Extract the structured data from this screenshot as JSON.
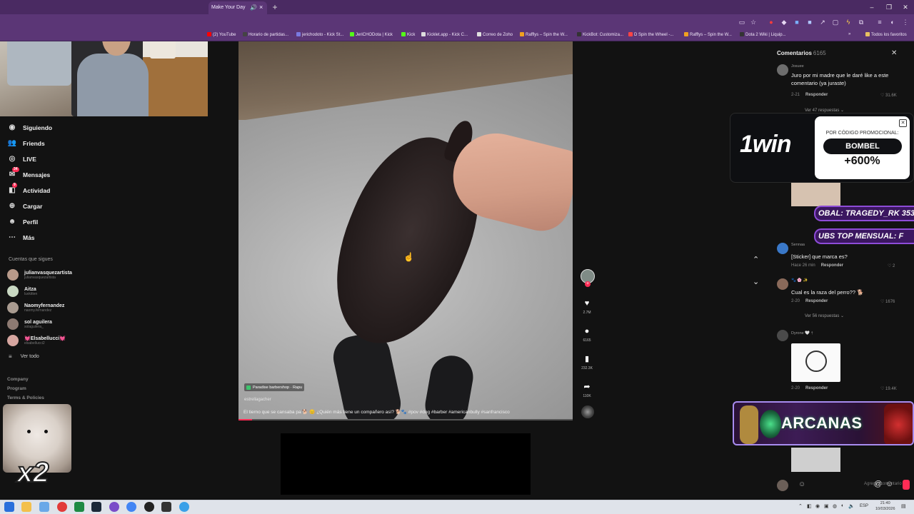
{
  "browser": {
    "active_tab_title": "Make Your Day",
    "bookmarks": [
      {
        "label": "(2) YouTube",
        "color": "#ff0000"
      },
      {
        "label": "Horario de partidas...",
        "color": "#444444"
      },
      {
        "label": "jerichodoto - Kick St...",
        "color": "#7a7ae0"
      },
      {
        "label": "JeriCHODota | Kick",
        "color": "#53fc18"
      },
      {
        "label": "Kick",
        "color": "#53fc18"
      },
      {
        "label": "Kicklet.app - Kick C...",
        "color": "#dddddd"
      },
      {
        "label": "Correo de Zoho",
        "color": "#e0e0e0"
      },
      {
        "label": "Rafflys – Spin the W...",
        "color": "#f0a020"
      },
      {
        "label": "KickBot: Customiza...",
        "color": "#333333"
      },
      {
        "label": "D Spin the Wheel -...",
        "color": "#ff4444"
      },
      {
        "label": "Rafflys – Spin the W...",
        "color": "#f0a020"
      },
      {
        "label": "Dota 2 Wiki | Liquip...",
        "color": "#333333"
      }
    ],
    "all_favorites": "Todos los favoritos"
  },
  "sidebar": {
    "nav": [
      {
        "label": "Siguiendo",
        "icon": "following-icon"
      },
      {
        "label": "Friends",
        "icon": "friends-icon"
      },
      {
        "label": "LIVE",
        "icon": "live-icon"
      },
      {
        "label": "Mensajes",
        "icon": "messages-icon",
        "badge": "34"
      },
      {
        "label": "Actividad",
        "icon": "activity-icon",
        "badge": "9"
      },
      {
        "label": "Cargar",
        "icon": "upload-icon"
      },
      {
        "label": "Perfil",
        "icon": "profile-icon"
      },
      {
        "label": "Más",
        "icon": "more-icon"
      }
    ],
    "following_title": "Cuentas que sigues",
    "following": [
      {
        "name": "julianvasquezartista",
        "handle": "julianvasquezartista",
        "color": "#b89a8a"
      },
      {
        "name": "Aitza",
        "handle": "luvkitten",
        "color": "#c9d8c2"
      },
      {
        "name": "Naomyfernandez",
        "handle": "naomy.fernandez",
        "color": "#a99b90"
      },
      {
        "name": "sol aguilera",
        "handle": "solaguilera_",
        "color": "#8d7a72"
      },
      {
        "name": "💓Elsabellucci💓",
        "handle": "elsabellucci2",
        "color": "#d6a6a0"
      }
    ],
    "see_all": "Ver todo",
    "footer": [
      "Company",
      "Program",
      "Terms & Policies"
    ]
  },
  "overlay": {
    "multiplier": "x2"
  },
  "video": {
    "tag": "Paradise barbershop · Rapu",
    "author": "estrellagacher",
    "caption": "El tierno que se cansaba pa 🐕 😊 ¿Quién más tiene un compañero así? 🐕🐾 #pov #dog #barber #americanbully #sanfrancisco",
    "progress": 0.04
  },
  "actions": [
    {
      "name": "like",
      "icon": "heart-icon",
      "glyph": "♥",
      "count": "2.7M"
    },
    {
      "name": "comment",
      "icon": "comment-icon",
      "glyph": "●",
      "count": "6165"
    },
    {
      "name": "save",
      "icon": "bookmark-icon",
      "glyph": "▮",
      "count": "232.3K"
    },
    {
      "name": "share",
      "icon": "share-icon",
      "glyph": "➦",
      "count": "110K"
    }
  ],
  "comments_panel": {
    "title": "Comentarios",
    "count": "6165",
    "comments": [
      {
        "user": "Josuee",
        "text": "Juro por mi madre que le daré like a este comentario (ya juraste)",
        "date": "2-21",
        "likes": "♡ 31.6K",
        "more": "Ver 47 respuestas ⌄"
      },
      {
        "user": "Sennaa",
        "text": "[Sticker] que marca es?",
        "date": "Hace 26 min",
        "likes": "♡ 2",
        "more": ""
      },
      {
        "user": "🐾 🌸 ✨",
        "text": "Cual es la raza del perro?? 🐕",
        "date": "2-20",
        "likes": "♡ 1676",
        "more": "Ver 56 respuestas ⌄"
      },
      {
        "user": "Dyrone 🤍 †",
        "text": "",
        "date": "2-20",
        "likes": "♡ 19.4K",
        "more": ""
      }
    ],
    "reply_label": "Responder",
    "input_placeholder": "Agregar comentario"
  },
  "ad": {
    "brand": "1win",
    "promo_label": "POR CÓDIGO PROMOCIONAL:",
    "code": "BOMBEL",
    "bonus": "+600%"
  },
  "banners": [
    "OBAL: TRAGEDY_RK 353",
    "UBS      TOP MENSUAL: F"
  ],
  "arcanas": "ARCANAS",
  "taskbar": {
    "lang": "ESP",
    "time": "21:40",
    "date": "10/03/2026"
  }
}
